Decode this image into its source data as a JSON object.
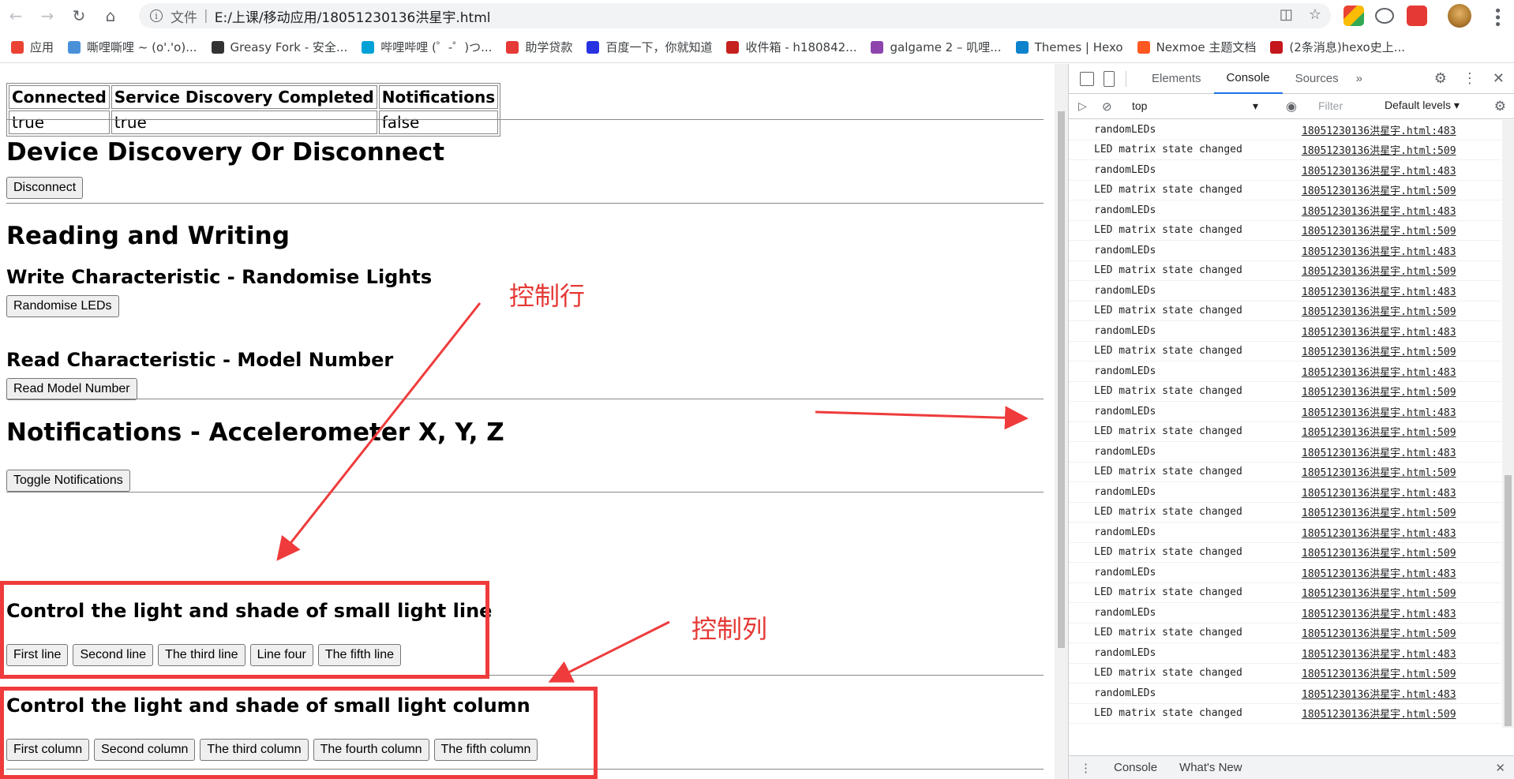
{
  "browser": {
    "scheme": "文件",
    "url": "E:/上课/移动应用/18051230136洪星宇.html"
  },
  "bookmarks": [
    {
      "label": "应用",
      "color": "#ea4335"
    },
    {
      "label": "嘶哩嘶哩 ~ (o'.'o)...",
      "color": "#4a90d9"
    },
    {
      "label": "Greasy Fork - 安全...",
      "color": "#333333"
    },
    {
      "label": "哔哩哔哩 (゜-゜)つ...",
      "color": "#00a1d6"
    },
    {
      "label": "助学贷款",
      "color": "#e53935"
    },
    {
      "label": "百度一下，你就知道",
      "color": "#2932e1"
    },
    {
      "label": "收件箱 - h180842...",
      "color": "#c5221f"
    },
    {
      "label": "galgame 2 – 叽哩...",
      "color": "#8e44ad"
    },
    {
      "label": "Themes | Hexo",
      "color": "#0e83cd"
    },
    {
      "label": "Nexmoe 主题文档",
      "color": "#ff5722"
    },
    {
      "label": "(2条消息)hexo史上...",
      "color": "#c4161c"
    }
  ],
  "status_table": {
    "headers": [
      "Connected",
      "Service Discovery Completed",
      "Notifications"
    ],
    "values": [
      "true",
      "true",
      "false"
    ]
  },
  "sections": {
    "discovery_title": "Device Discovery Or Disconnect",
    "disconnect_label": "Disconnect",
    "rw_title": "Reading and Writing",
    "write_title": "Write Characteristic - Randomise Lights",
    "randomise_label": "Randomise LEDs",
    "read_title": "Read Characteristic - Model Number",
    "read_label": "Read Model Number",
    "notif_title": "Notifications - Accelerometer X, Y, Z",
    "toggle_label": "Toggle Notifications",
    "line_title": "Control the light and shade of small light line",
    "line_buttons": [
      "First line",
      "Second line",
      "The third line",
      "Line four",
      "The fifth line"
    ],
    "column_title": "Control the light and shade of small light column",
    "column_buttons": [
      "First column",
      "Second column",
      "The third column",
      "The fourth column",
      "The fifth column"
    ]
  },
  "annotations": {
    "rows_label": "控制行",
    "columns_label": "控制列",
    "color": "#ef3b3b"
  },
  "devtools": {
    "tabs": [
      "Elements",
      "Console",
      "Sources"
    ],
    "active_tab": "Console",
    "more_tabs": "»",
    "context": "top",
    "filter_placeholder": "Filter",
    "levels": "Default levels",
    "logs": [
      {
        "msg": "randomLEDs",
        "src": "18051230136洪星宇.html:483"
      },
      {
        "msg": "LED matrix state changed",
        "src": "18051230136洪星宇.html:509"
      },
      {
        "msg": "randomLEDs",
        "src": "18051230136洪星宇.html:483"
      },
      {
        "msg": "LED matrix state changed",
        "src": "18051230136洪星宇.html:509"
      },
      {
        "msg": "randomLEDs",
        "src": "18051230136洪星宇.html:483"
      },
      {
        "msg": "LED matrix state changed",
        "src": "18051230136洪星宇.html:509"
      },
      {
        "msg": "randomLEDs",
        "src": "18051230136洪星宇.html:483"
      },
      {
        "msg": "LED matrix state changed",
        "src": "18051230136洪星宇.html:509"
      },
      {
        "msg": "randomLEDs",
        "src": "18051230136洪星宇.html:483"
      },
      {
        "msg": "LED matrix state changed",
        "src": "18051230136洪星宇.html:509"
      },
      {
        "msg": "randomLEDs",
        "src": "18051230136洪星宇.html:483"
      },
      {
        "msg": "LED matrix state changed",
        "src": "18051230136洪星宇.html:509"
      },
      {
        "msg": "randomLEDs",
        "src": "18051230136洪星宇.html:483"
      },
      {
        "msg": "LED matrix state changed",
        "src": "18051230136洪星宇.html:509"
      },
      {
        "msg": "randomLEDs",
        "src": "18051230136洪星宇.html:483"
      },
      {
        "msg": "LED matrix state changed",
        "src": "18051230136洪星宇.html:509"
      },
      {
        "msg": "randomLEDs",
        "src": "18051230136洪星宇.html:483"
      },
      {
        "msg": "LED matrix state changed",
        "src": "18051230136洪星宇.html:509"
      },
      {
        "msg": "randomLEDs",
        "src": "18051230136洪星宇.html:483"
      },
      {
        "msg": "LED matrix state changed",
        "src": "18051230136洪星宇.html:509"
      },
      {
        "msg": "randomLEDs",
        "src": "18051230136洪星宇.html:483"
      },
      {
        "msg": "LED matrix state changed",
        "src": "18051230136洪星宇.html:509"
      },
      {
        "msg": "randomLEDs",
        "src": "18051230136洪星宇.html:483"
      },
      {
        "msg": "LED matrix state changed",
        "src": "18051230136洪星宇.html:509"
      },
      {
        "msg": "randomLEDs",
        "src": "18051230136洪星宇.html:483"
      },
      {
        "msg": "LED matrix state changed",
        "src": "18051230136洪星宇.html:509"
      },
      {
        "msg": "randomLEDs",
        "src": "18051230136洪星宇.html:483"
      },
      {
        "msg": "LED matrix state changed",
        "src": "18051230136洪星宇.html:509"
      },
      {
        "msg": "randomLEDs",
        "src": "18051230136洪星宇.html:483"
      },
      {
        "msg": "LED matrix state changed",
        "src": "18051230136洪星宇.html:509"
      }
    ],
    "drawer_tabs": [
      "Console",
      "What's New"
    ]
  }
}
